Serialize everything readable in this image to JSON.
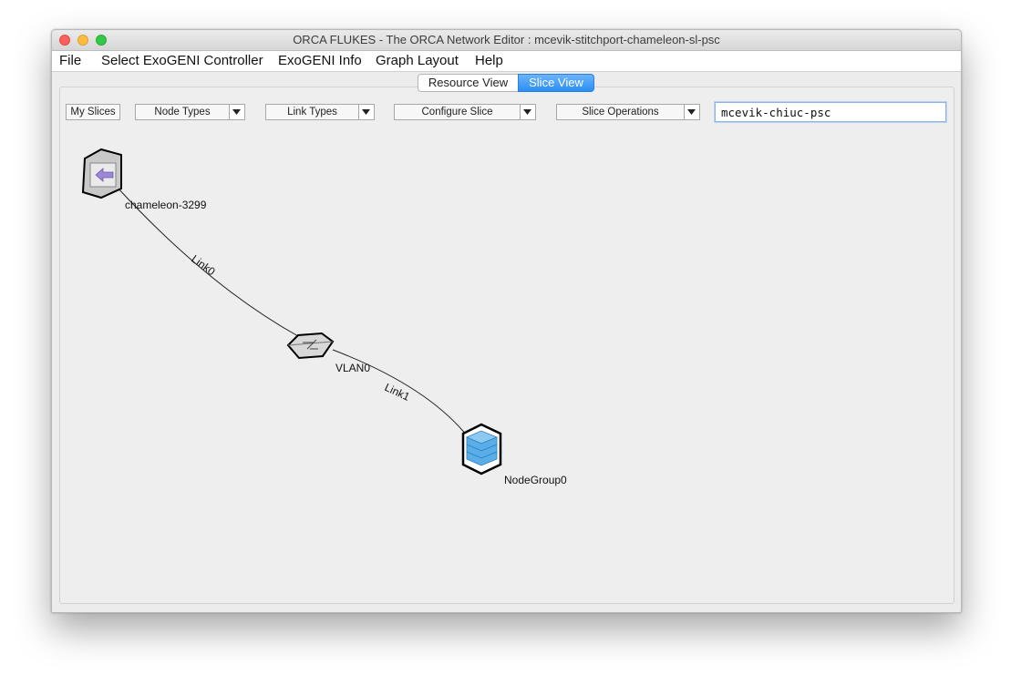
{
  "window": {
    "title": "ORCA FLUKES - The ORCA Network Editor : mcevik-stitchport-chameleon-sl-psc"
  },
  "menubar": {
    "items": [
      "File",
      "Select ExoGENI Controller",
      "ExoGENI Info",
      "Graph Layout",
      "Help"
    ]
  },
  "view_tabs": {
    "resource_view": "Resource View",
    "slice_view": "Slice View",
    "selected": "Slice View"
  },
  "toolbar": {
    "my_slices": "My Slices",
    "node_types": "Node Types",
    "link_types": "Link Types",
    "configure_slice": "Configure Slice",
    "slice_operations": "Slice Operations",
    "slice_name_value": "mcevik-chiuc-psc"
  },
  "graph": {
    "nodes": [
      {
        "id": "chameleon-3299",
        "label": "chameleon-3299",
        "icon": "stitchport-icon"
      },
      {
        "id": "VLAN0",
        "label": "VLAN0",
        "icon": "vlan-switch-icon"
      },
      {
        "id": "NodeGroup0",
        "label": "NodeGroup0",
        "icon": "nodegroup-icon"
      }
    ],
    "edges": [
      {
        "id": "Link0",
        "label": "Link0",
        "from": "chameleon-3299",
        "to": "VLAN0"
      },
      {
        "id": "Link1",
        "label": "Link1",
        "from": "VLAN0",
        "to": "NodeGroup0"
      }
    ]
  },
  "colors": {
    "selected_tab": "#2a8ef5",
    "nodegroup_fill": "#5aaee8",
    "stitchport_arrow": "#9b86d8"
  }
}
